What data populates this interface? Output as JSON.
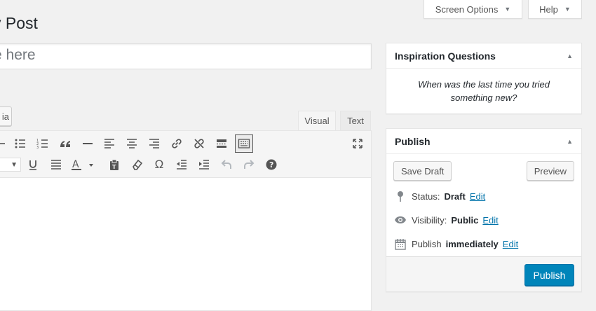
{
  "screen_meta": {
    "screen_options_label": "Screen Options",
    "help_label": "Help"
  },
  "page": {
    "title": "v Post"
  },
  "title_field": {
    "placeholder": "e here"
  },
  "add_media": {
    "label": "ia"
  },
  "editor": {
    "tabs": {
      "visual": "Visual",
      "text": "Text"
    },
    "toolbar_row1": [
      "bulleted-list-icon",
      "numbered-list-icon",
      "blockquote-icon",
      "horizontal-line-icon",
      "align-left-icon",
      "align-center-icon",
      "align-right-icon",
      "insert-link-icon",
      "remove-link-icon",
      "read-more-icon",
      "toolbar-toggle-icon",
      "fullscreen-icon"
    ],
    "toolbar_row2": [
      "underline-icon",
      "justify-icon",
      "text-color-icon",
      "paste-as-text-icon",
      "clear-formatting-icon",
      "special-character-icon",
      "decrease-indent-icon",
      "increase-indent-icon",
      "undo-icon",
      "redo-icon",
      "help-icon"
    ]
  },
  "inspiration": {
    "header": "Inspiration Questions",
    "question": "When was the last time you tried something new?"
  },
  "publish": {
    "header": "Publish",
    "save_draft": "Save Draft",
    "preview": "Preview",
    "status_label": "Status:",
    "status_value": "Draft",
    "visibility_label": "Visibility:",
    "visibility_value": "Public",
    "schedule_label": "Publish",
    "schedule_value": "immediately",
    "edit_link": "Edit",
    "publish_button": "Publish"
  },
  "colors": {
    "primary": "#0085ba",
    "link": "#0073aa",
    "background": "#f1f1f1"
  }
}
